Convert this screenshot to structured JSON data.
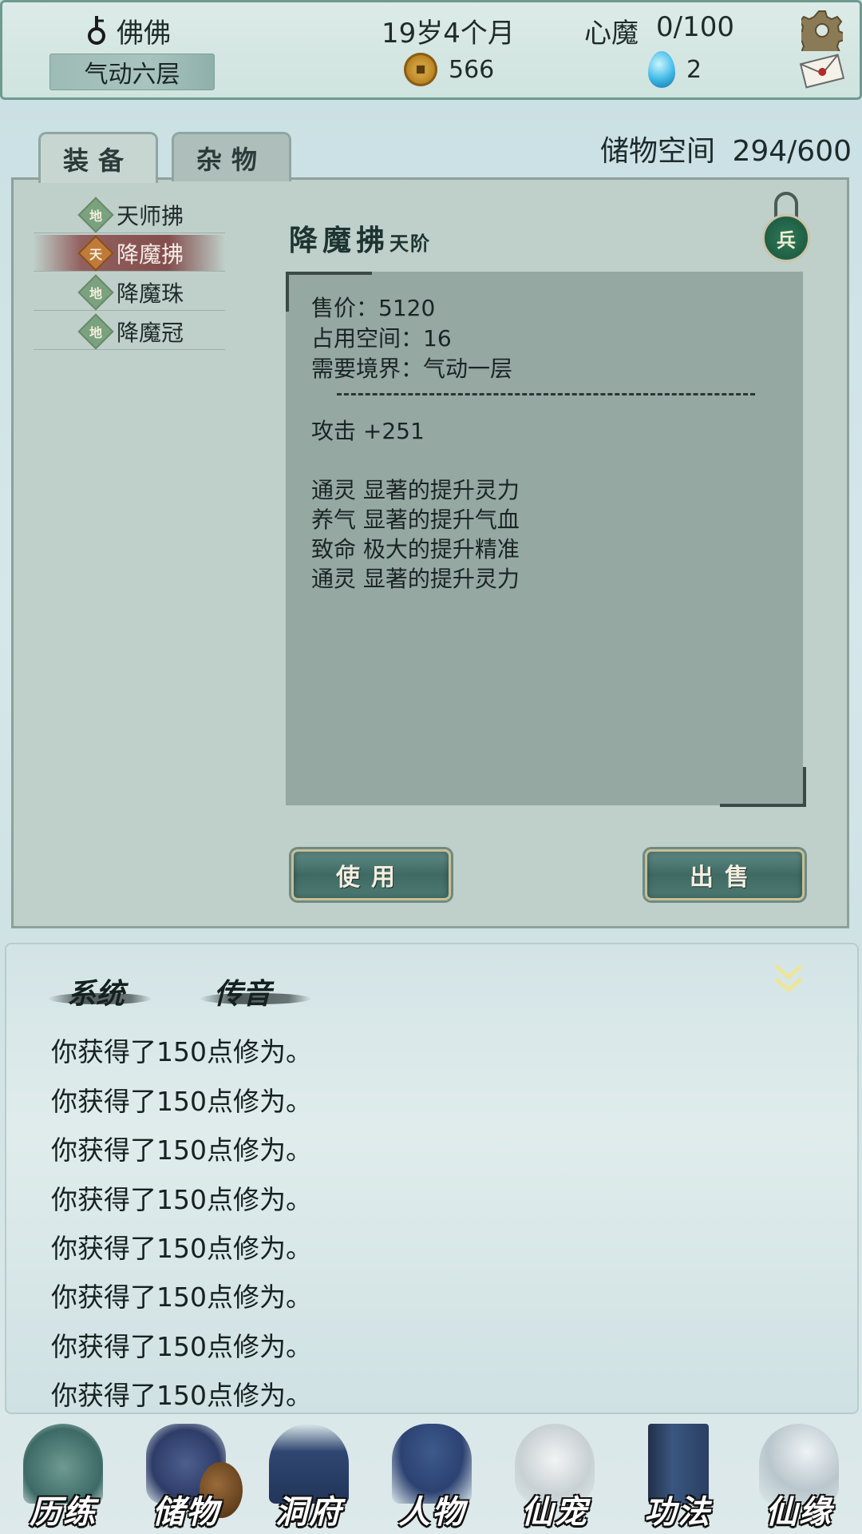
{
  "header": {
    "player_name": "佛佛",
    "realm": "气动六层",
    "age": "19岁4个月",
    "heart_demon_label": "心魔",
    "heart_demon_value": "0/100",
    "coins": "566",
    "gems": "2"
  },
  "tabs": [
    {
      "label": "装备",
      "active": true
    },
    {
      "label": "杂物",
      "active": false
    }
  ],
  "storage": {
    "label": "储物空间",
    "value": "294/600"
  },
  "item_list": [
    {
      "grade": "地",
      "name": "天师拂",
      "selected": false
    },
    {
      "grade": "天",
      "name": "降魔拂",
      "selected": true
    },
    {
      "grade": "地",
      "name": "降魔珠",
      "selected": false
    },
    {
      "grade": "地",
      "name": "降魔冠",
      "selected": false
    }
  ],
  "item_detail": {
    "name": "降魔拂",
    "grade": "天阶",
    "type_badge": "兵",
    "price": "售价：5120",
    "space": "占用空间：16",
    "realm_req": "需要境界：气动一层",
    "attack": "攻击 +251",
    "effects": [
      "通灵 显著的提升灵力",
      "养气 显著的提升气血",
      "致命 极大的提升精准",
      "通灵 显著的提升灵力"
    ]
  },
  "buttons": {
    "use": "使用",
    "sell": "出售"
  },
  "log": {
    "tabs": [
      "系统",
      "传音"
    ],
    "lines": [
      "你获得了150点修为。",
      "你获得了150点修为。",
      "你获得了150点修为。",
      "你获得了150点修为。",
      "你获得了150点修为。",
      "你获得了150点修为。",
      "你获得了150点修为。",
      "你获得了150点修为。"
    ]
  },
  "nav": [
    {
      "label": "历练",
      "icon": "mountain-icon"
    },
    {
      "label": "储物",
      "icon": "gourd-bag-icon"
    },
    {
      "label": "洞府",
      "icon": "pagoda-icon"
    },
    {
      "label": "人物",
      "icon": "character-icon"
    },
    {
      "label": "仙宠",
      "icon": "ghost-pet-icon"
    },
    {
      "label": "功法",
      "icon": "scroll-book-icon"
    },
    {
      "label": "仙缘",
      "icon": "crane-icon"
    }
  ],
  "colors": {
    "panel": "#bfcfc9",
    "detail_box": "#95a8a2",
    "selected_row": "#8a3f3f",
    "button": "#4d7a73"
  }
}
